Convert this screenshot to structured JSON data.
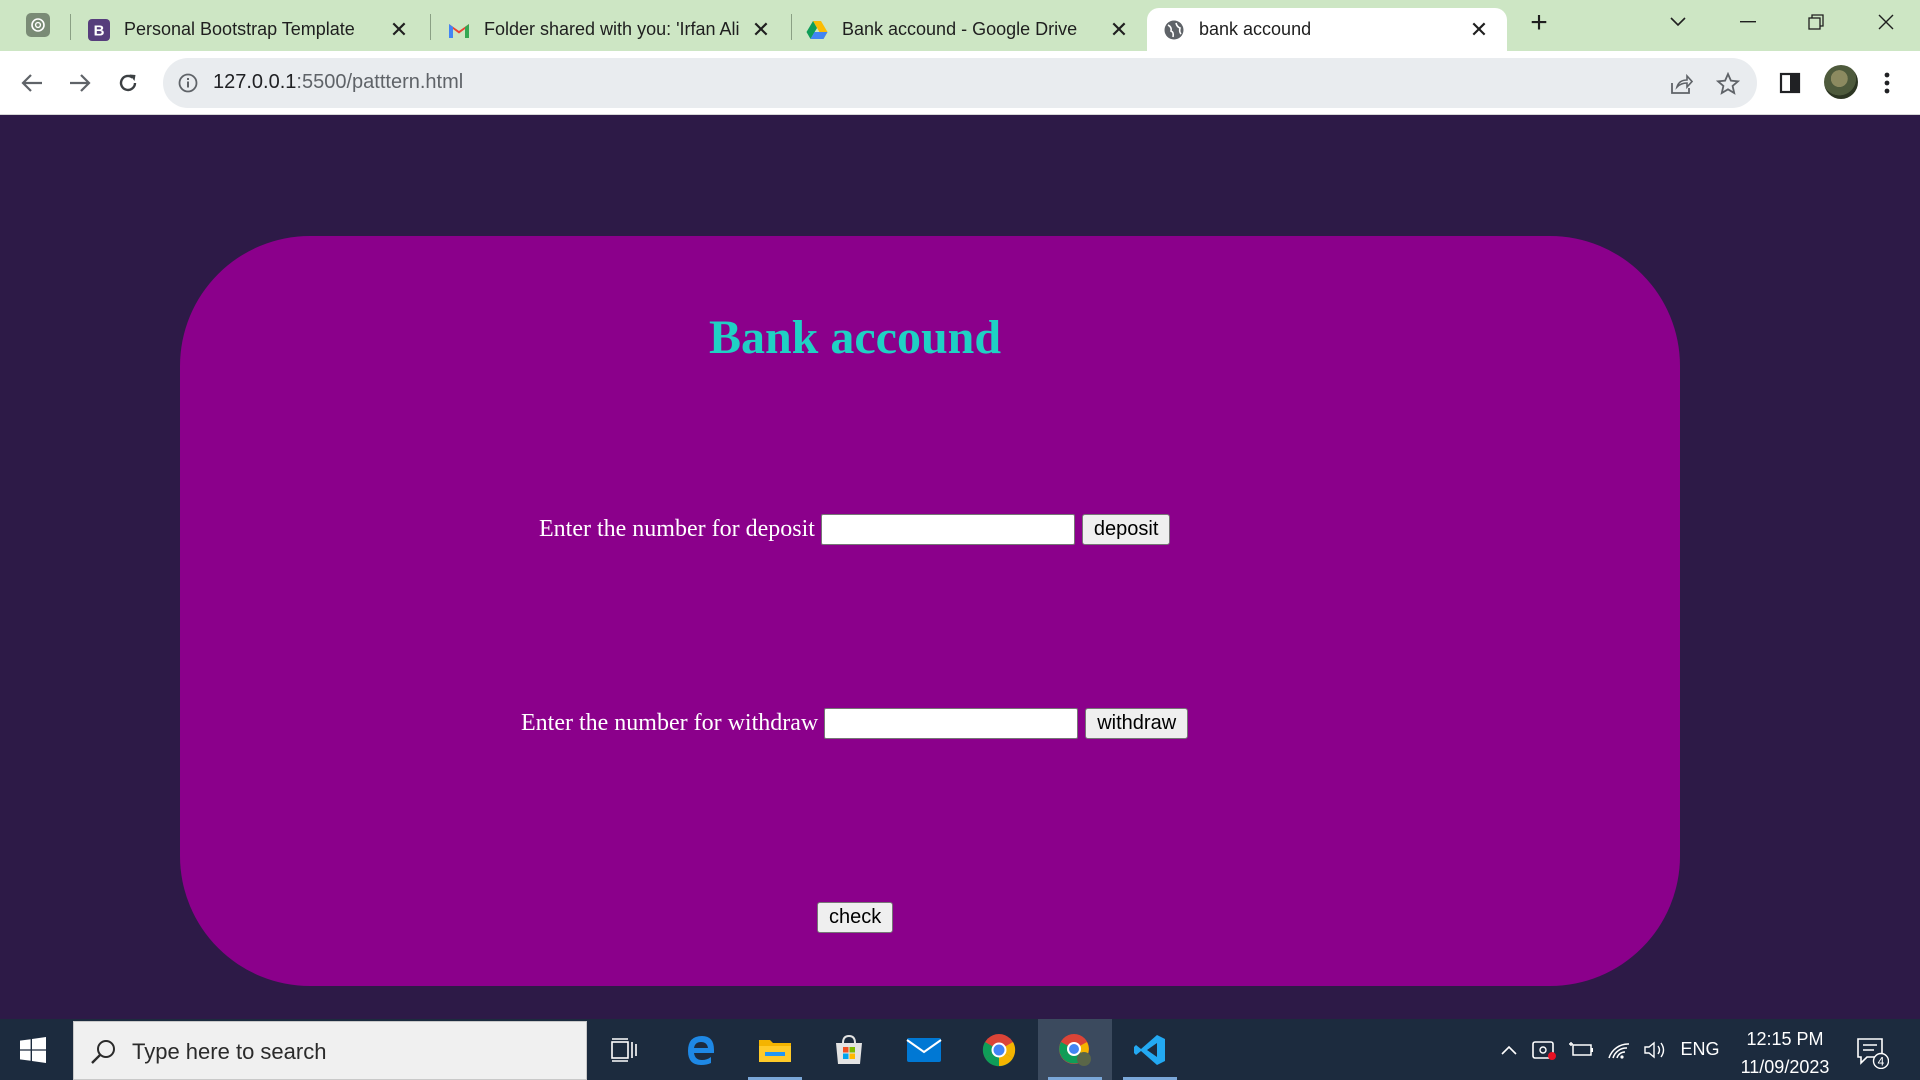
{
  "browser": {
    "tabs": [
      {
        "title": "Personal Bootstrap Template",
        "favicon": "bootstrap-icon"
      },
      {
        "title": "Folder shared with you: 'Irfan Ali",
        "favicon": "gmail-icon"
      },
      {
        "title": "Bank accound - Google Drive",
        "favicon": "google-drive-icon"
      },
      {
        "title": "bank accound",
        "favicon": "globe-icon",
        "active": true
      }
    ],
    "url_host": "127.0.0.1",
    "url_path": ":5500/patttern.html"
  },
  "page": {
    "title": "Bank accound",
    "deposit": {
      "label": "Enter the number for deposit",
      "value": "",
      "button": "deposit"
    },
    "withdraw": {
      "label": "Enter the number for withdraw",
      "value": "",
      "button": "withdraw"
    },
    "check_button": "check",
    "colors": {
      "background": "#2d1a47",
      "card": "#8b008b",
      "title": "#1fd1c4"
    }
  },
  "taskbar": {
    "search_placeholder": "Type here to search",
    "language": "ENG",
    "time": "12:15 PM",
    "date": "11/09/2023",
    "notification_count": "4"
  }
}
